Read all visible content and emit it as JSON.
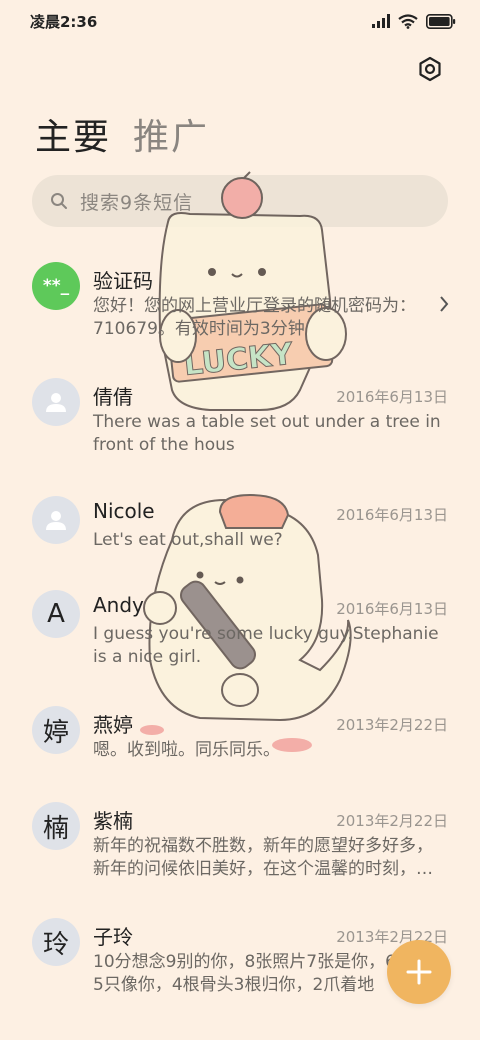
{
  "status_bar": {
    "time": "凌晨2:36"
  },
  "tabs": [
    {
      "label": "主要"
    },
    {
      "label": "推广"
    }
  ],
  "search": {
    "placeholder": "搜索9条短信"
  },
  "threads": [
    {
      "avatar_text": "**_",
      "name": "验证码",
      "date": "",
      "preview": "您好！您的网上营业厅登录的随机密码为：710679。有效时间为3分钟",
      "avatar_style": "green"
    },
    {
      "avatar_text": "",
      "name": "倩倩",
      "date": "2016年6月13日",
      "preview": "There was a table set out under a tree in front of the hous",
      "avatar_style": "person"
    },
    {
      "avatar_text": "",
      "name": "Nicole",
      "date": "2016年6月13日",
      "preview": "Let's eat out,shall we?",
      "avatar_style": "person"
    },
    {
      "avatar_text": "A",
      "name": "Andy",
      "date": "2016年6月13日",
      "preview": "I guess you're some lucky guy.Stephanie is a nice girl.",
      "avatar_style": "letter"
    },
    {
      "avatar_text": "婷",
      "name": "燕婷",
      "date": "2013年2月22日",
      "preview": "嗯。收到啦。同乐同乐。",
      "avatar_style": "letter"
    },
    {
      "avatar_text": "楠",
      "name": "紫楠",
      "date": "2013年2月22日",
      "preview": "新年的祝福数不胜数，新年的愿望好多好多，新年的问候依旧美好，在这个温馨的时刻，…",
      "avatar_style": "letter"
    },
    {
      "avatar_text": "玲",
      "name": "子玲",
      "date": "2013年2月22日",
      "preview": "10分想念9别的你，8张照片7张是你，6只小狗5只像你，4根骨头3根归你，2爪着地",
      "avatar_style": "letter"
    }
  ],
  "decoration": {
    "sticker_text": "LUCKY"
  },
  "colors": {
    "background": "#fdf0e3",
    "fab": "#f0b560",
    "verify_avatar": "#5ec95a"
  },
  "icons": {
    "settings": "settings-gear-icon",
    "search": "search-icon",
    "fab": "plus-icon"
  }
}
